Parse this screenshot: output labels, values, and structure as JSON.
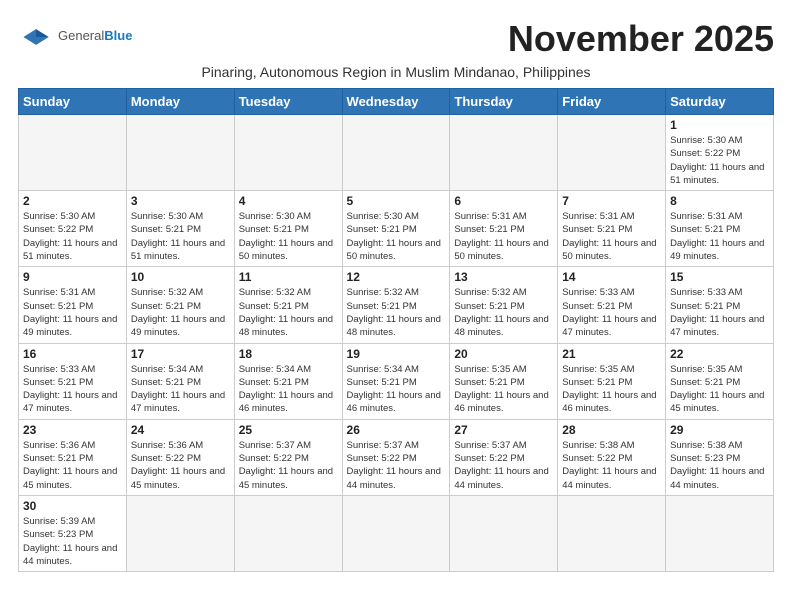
{
  "header": {
    "logo_general": "General",
    "logo_blue": "Blue",
    "month_title": "November 2025",
    "subtitle": "Pinaring, Autonomous Region in Muslim Mindanao, Philippines"
  },
  "weekdays": [
    "Sunday",
    "Monday",
    "Tuesday",
    "Wednesday",
    "Thursday",
    "Friday",
    "Saturday"
  ],
  "weeks": [
    [
      {
        "day": "",
        "info": ""
      },
      {
        "day": "",
        "info": ""
      },
      {
        "day": "",
        "info": ""
      },
      {
        "day": "",
        "info": ""
      },
      {
        "day": "",
        "info": ""
      },
      {
        "day": "",
        "info": ""
      },
      {
        "day": "1",
        "info": "Sunrise: 5:30 AM\nSunset: 5:22 PM\nDaylight: 11 hours\nand 51 minutes."
      }
    ],
    [
      {
        "day": "2",
        "info": "Sunrise: 5:30 AM\nSunset: 5:22 PM\nDaylight: 11 hours\nand 51 minutes."
      },
      {
        "day": "3",
        "info": "Sunrise: 5:30 AM\nSunset: 5:21 PM\nDaylight: 11 hours\nand 51 minutes."
      },
      {
        "day": "4",
        "info": "Sunrise: 5:30 AM\nSunset: 5:21 PM\nDaylight: 11 hours\nand 50 minutes."
      },
      {
        "day": "5",
        "info": "Sunrise: 5:30 AM\nSunset: 5:21 PM\nDaylight: 11 hours\nand 50 minutes."
      },
      {
        "day": "6",
        "info": "Sunrise: 5:31 AM\nSunset: 5:21 PM\nDaylight: 11 hours\nand 50 minutes."
      },
      {
        "day": "7",
        "info": "Sunrise: 5:31 AM\nSunset: 5:21 PM\nDaylight: 11 hours\nand 50 minutes."
      },
      {
        "day": "8",
        "info": "Sunrise: 5:31 AM\nSunset: 5:21 PM\nDaylight: 11 hours\nand 49 minutes."
      }
    ],
    [
      {
        "day": "9",
        "info": "Sunrise: 5:31 AM\nSunset: 5:21 PM\nDaylight: 11 hours\nand 49 minutes."
      },
      {
        "day": "10",
        "info": "Sunrise: 5:32 AM\nSunset: 5:21 PM\nDaylight: 11 hours\nand 49 minutes."
      },
      {
        "day": "11",
        "info": "Sunrise: 5:32 AM\nSunset: 5:21 PM\nDaylight: 11 hours\nand 48 minutes."
      },
      {
        "day": "12",
        "info": "Sunrise: 5:32 AM\nSunset: 5:21 PM\nDaylight: 11 hours\nand 48 minutes."
      },
      {
        "day": "13",
        "info": "Sunrise: 5:32 AM\nSunset: 5:21 PM\nDaylight: 11 hours\nand 48 minutes."
      },
      {
        "day": "14",
        "info": "Sunrise: 5:33 AM\nSunset: 5:21 PM\nDaylight: 11 hours\nand 47 minutes."
      },
      {
        "day": "15",
        "info": "Sunrise: 5:33 AM\nSunset: 5:21 PM\nDaylight: 11 hours\nand 47 minutes."
      }
    ],
    [
      {
        "day": "16",
        "info": "Sunrise: 5:33 AM\nSunset: 5:21 PM\nDaylight: 11 hours\nand 47 minutes."
      },
      {
        "day": "17",
        "info": "Sunrise: 5:34 AM\nSunset: 5:21 PM\nDaylight: 11 hours\nand 47 minutes."
      },
      {
        "day": "18",
        "info": "Sunrise: 5:34 AM\nSunset: 5:21 PM\nDaylight: 11 hours\nand 46 minutes."
      },
      {
        "day": "19",
        "info": "Sunrise: 5:34 AM\nSunset: 5:21 PM\nDaylight: 11 hours\nand 46 minutes."
      },
      {
        "day": "20",
        "info": "Sunrise: 5:35 AM\nSunset: 5:21 PM\nDaylight: 11 hours\nand 46 minutes."
      },
      {
        "day": "21",
        "info": "Sunrise: 5:35 AM\nSunset: 5:21 PM\nDaylight: 11 hours\nand 46 minutes."
      },
      {
        "day": "22",
        "info": "Sunrise: 5:35 AM\nSunset: 5:21 PM\nDaylight: 11 hours\nand 45 minutes."
      }
    ],
    [
      {
        "day": "23",
        "info": "Sunrise: 5:36 AM\nSunset: 5:21 PM\nDaylight: 11 hours\nand 45 minutes."
      },
      {
        "day": "24",
        "info": "Sunrise: 5:36 AM\nSunset: 5:22 PM\nDaylight: 11 hours\nand 45 minutes."
      },
      {
        "day": "25",
        "info": "Sunrise: 5:37 AM\nSunset: 5:22 PM\nDaylight: 11 hours\nand 45 minutes."
      },
      {
        "day": "26",
        "info": "Sunrise: 5:37 AM\nSunset: 5:22 PM\nDaylight: 11 hours\nand 44 minutes."
      },
      {
        "day": "27",
        "info": "Sunrise: 5:37 AM\nSunset: 5:22 PM\nDaylight: 11 hours\nand 44 minutes."
      },
      {
        "day": "28",
        "info": "Sunrise: 5:38 AM\nSunset: 5:22 PM\nDaylight: 11 hours\nand 44 minutes."
      },
      {
        "day": "29",
        "info": "Sunrise: 5:38 AM\nSunset: 5:23 PM\nDaylight: 11 hours\nand 44 minutes."
      }
    ],
    [
      {
        "day": "30",
        "info": "Sunrise: 5:39 AM\nSunset: 5:23 PM\nDaylight: 11 hours\nand 44 minutes."
      },
      {
        "day": "",
        "info": ""
      },
      {
        "day": "",
        "info": ""
      },
      {
        "day": "",
        "info": ""
      },
      {
        "day": "",
        "info": ""
      },
      {
        "day": "",
        "info": ""
      },
      {
        "day": "",
        "info": ""
      }
    ]
  ]
}
